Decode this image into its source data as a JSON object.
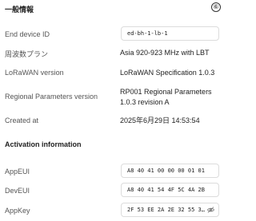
{
  "general": {
    "title": "一般情報",
    "badge": "⑥",
    "end_device_id_label": "End device ID",
    "end_device_id_value": "ed-bh-1-lb-1",
    "frequency_plan_label": "周波数プラン",
    "frequency_plan_value": "Asia 920-923 MHz with LBT",
    "lorawan_version_label": "LoRaWAN version",
    "lorawan_version_value": "LoRaWAN Specification 1.0.3",
    "regional_params_label": "Regional Parameters version",
    "regional_params_value_line1": "RP001 Regional Parameters",
    "regional_params_value_line2": "1.0.3 revision A",
    "created_at_label": "Created at",
    "created_at_value": "2025年6月29日 14:53:54"
  },
  "activation": {
    "title": "Activation information",
    "app_eui_label": "AppEUI",
    "app_eui_value": "A8 40 41 00 00 00 01 01",
    "dev_eui_label": "DevEUI",
    "dev_eui_value": "A8 40 41 54 4F 5C 4A 2B",
    "app_key_label": "AppKey",
    "app_key_value": "2F 53 EE 2A 2E 32 55 35...",
    "app_key_icon": "eye-off-icon"
  }
}
